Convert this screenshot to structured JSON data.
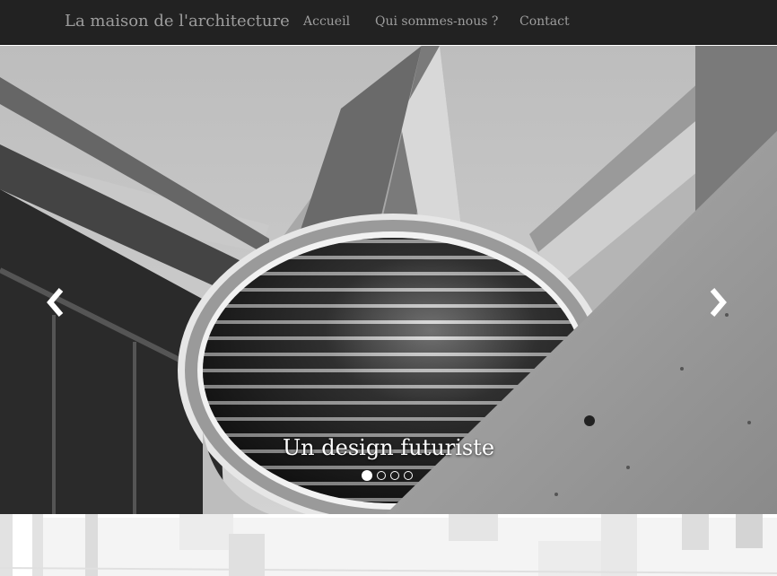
{
  "navbar": {
    "brand": "La maison de l'architecture",
    "links": [
      "Accueil",
      "Qui sommes-nous ?",
      "Contact"
    ],
    "background": "#222222",
    "text_color": "#9d9d9d"
  },
  "carousel": {
    "caption": "Un design futuriste",
    "slide_count": 4,
    "active_index": 0,
    "prev_icon": "chevron-left-icon",
    "next_icon": "chevron-right-icon"
  },
  "section_below": {
    "image": "architecture-photo-white"
  }
}
